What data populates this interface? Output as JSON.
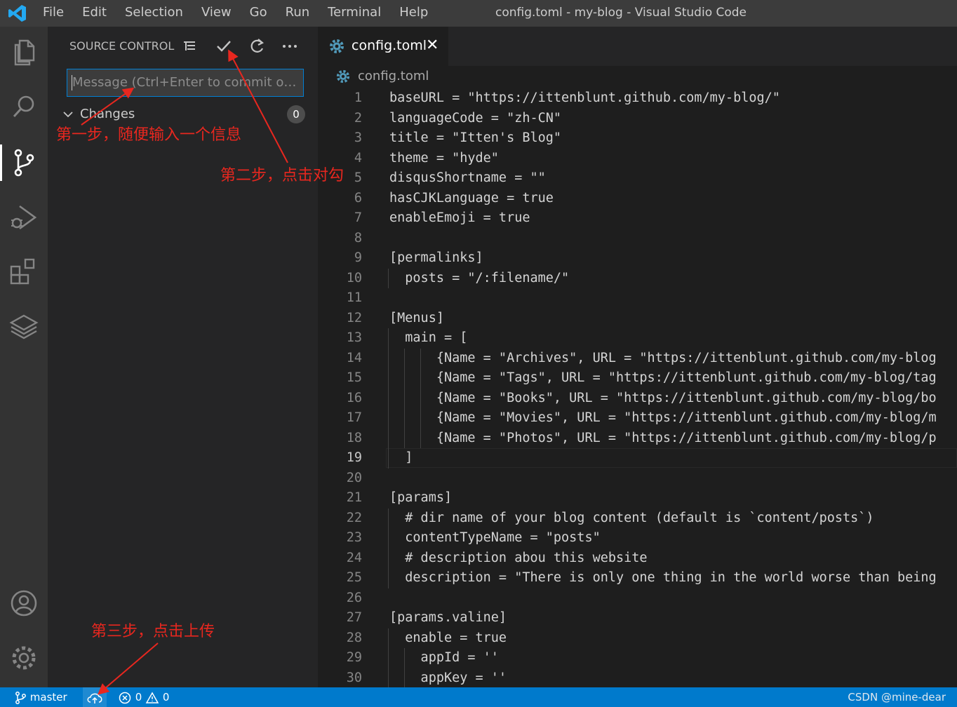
{
  "window": {
    "title": "config.toml - my-blog - Visual Studio Code"
  },
  "menu": [
    "File",
    "Edit",
    "Selection",
    "View",
    "Go",
    "Run",
    "Terminal",
    "Help"
  ],
  "activity_bar": [
    "explorer-icon",
    "search-icon",
    "source-control-icon",
    "run-debug-icon",
    "extensions-icon",
    "layers-icon",
    "account-icon",
    "settings-gear-icon"
  ],
  "source_control": {
    "title": "SOURCE CONTROL",
    "message_placeholder": "Message (Ctrl+Enter to commit on 'master')",
    "changes_label": "Changes",
    "changes_count": "0"
  },
  "annotations": {
    "step1": "第一步，随便输入一个信息",
    "step2": "第二步，点击对勾",
    "step3": "第三步，点击上传"
  },
  "tab": {
    "label": "config.toml",
    "close": "✕"
  },
  "breadcrumb": "config.toml",
  "editor": {
    "current_line": 19,
    "lines": [
      "baseURL = \"https://ittenblunt.github.com/my-blog/\"",
      "languageCode = \"zh-CN\"",
      "title = \"Itten's Blog\"",
      "theme = \"hyde\"",
      "disqusShortname = \"\"",
      "hasCJKLanguage = true",
      "enableEmoji = true",
      "",
      "[permalinks]",
      "  posts = \"/:filename/\"",
      "",
      "[Menus]",
      "  main = [",
      "      {Name = \"Archives\", URL = \"https://ittenblunt.github.com/my-blog",
      "      {Name = \"Tags\", URL = \"https://ittenblunt.github.com/my-blog/tag",
      "      {Name = \"Books\", URL = \"https://ittenblunt.github.com/my-blog/bo",
      "      {Name = \"Movies\", URL = \"https://ittenblunt.github.com/my-blog/m",
      "      {Name = \"Photos\", URL = \"https://ittenblunt.github.com/my-blog/p",
      "  ]",
      "",
      "[params]",
      "  # dir name of your blog content (default is `content/posts`)",
      "  contentTypeName = \"posts\"",
      "  # description abou this website",
      "  description = \"There is only one thing in the world worse than being",
      "",
      "[params.valine]",
      "  enable = true",
      "    appId = ''",
      "    appKey = ''"
    ]
  },
  "status_bar": {
    "branch": "master",
    "errors": "0",
    "warnings": "0",
    "watermark": "CSDN @mine-dear"
  },
  "colors": {
    "accent": "#007acc",
    "annotation": "#e8271f"
  }
}
